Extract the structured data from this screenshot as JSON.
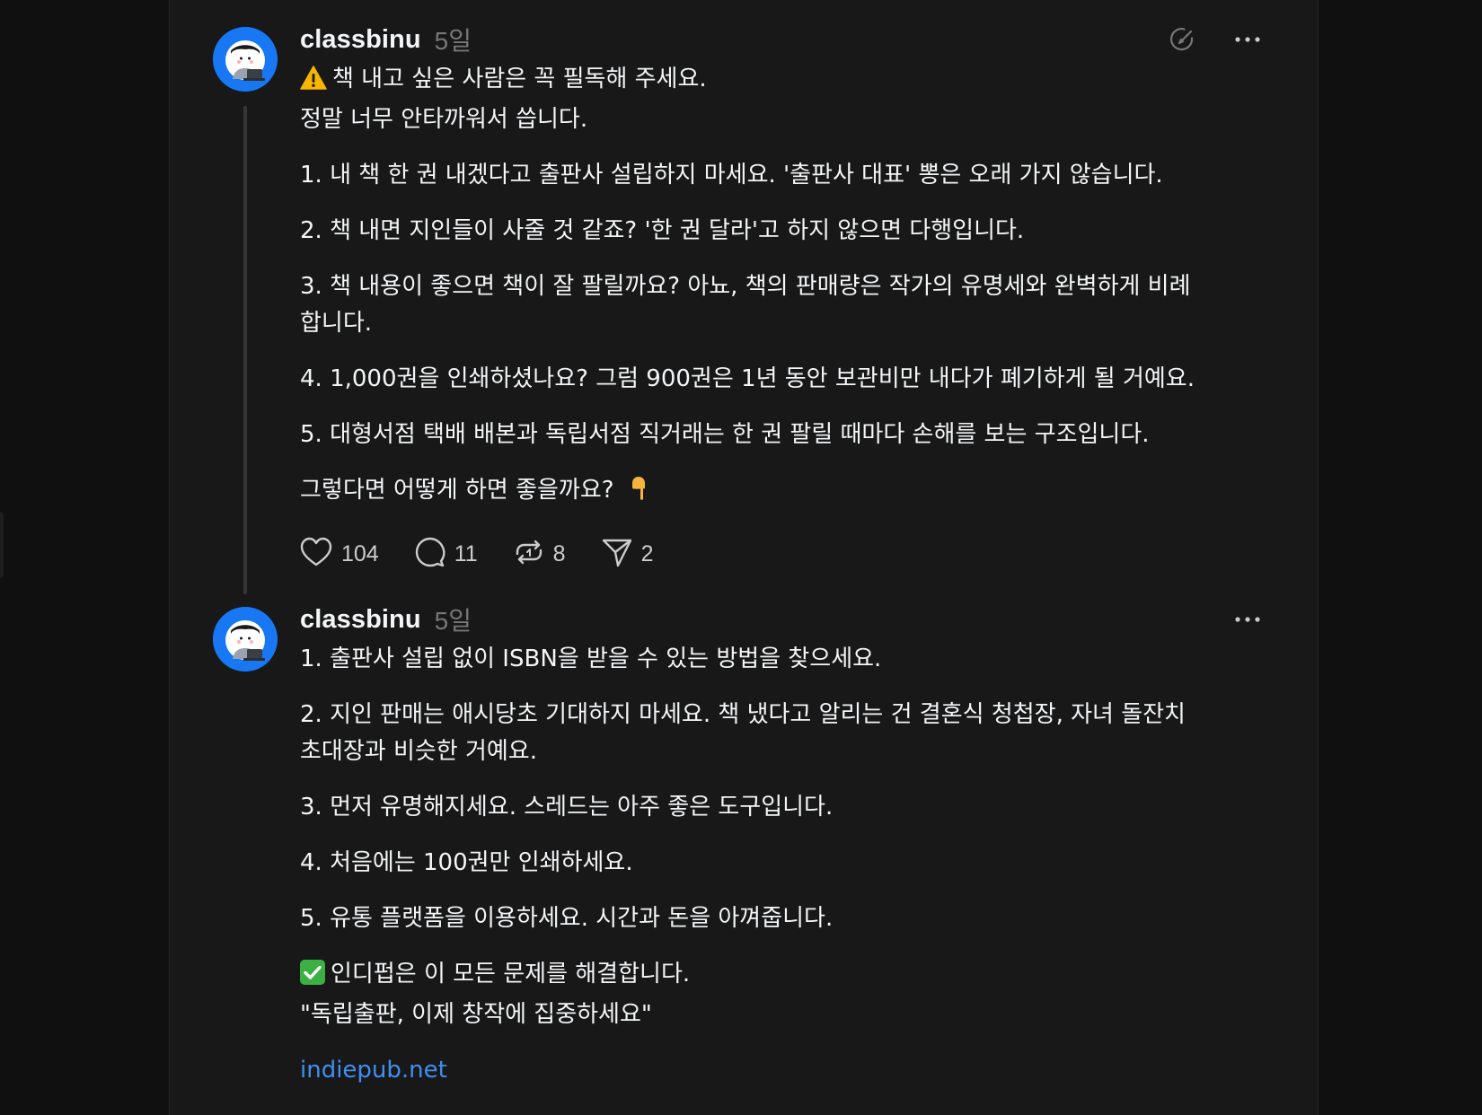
{
  "post1": {
    "username": "classbinu",
    "timestamp": "5일",
    "intro_line1": "책 내고 싶은 사람은 꼭 필독해 주세요.",
    "intro_line2": "정말 너무 안타까워서 씁니다.",
    "items": [
      {
        "lines": [
          "1. 내 책 한 권 내겠다고 출판사 설립하지 마세요. '출판사 대표' 뽕은 오래 가지 않습니다."
        ]
      },
      {
        "lines": [
          "2. 책 내면 지인들이 사줄 것 같죠? '한 권 달라'고 하지 않으면 다행입니다."
        ]
      },
      {
        "lines": [
          "3. 책 내용이 좋으면 책이 잘 팔릴까요? 아뇨, 책의 판매량은 작가의 유명세와 완벽하게 비례",
          "합니다."
        ]
      },
      {
        "lines": [
          "4. 1,000권을 인쇄하셨나요? 그럼 900권은 1년 동안 보관비만 내다가 폐기하게 될 거예요."
        ]
      },
      {
        "lines": [
          "5. 대형서점 택배 배본과 독립서점 직거래는 한 권 팔릴 때마다 손해를 보는 구조입니다."
        ]
      }
    ],
    "closing": "그렇다면 어떻게 하면 좋을까요?",
    "counts": {
      "likes": "104",
      "replies": "11",
      "reposts": "8",
      "shares": "2"
    }
  },
  "post2": {
    "username": "classbinu",
    "timestamp": "5일",
    "items": [
      {
        "lines": [
          "1. 출판사 설립 없이 ISBN을 받을 수 있는 방법을 찾으세요."
        ]
      },
      {
        "lines": [
          "2. 지인 판매는 애시당초 기대하지 마세요. 책 냈다고 알리는 건 결혼식 청첩장, 자녀 돌잔치",
          "초대장과 비슷한 거예요."
        ]
      },
      {
        "lines": [
          "3. 먼저 유명해지세요. 스레드는 아주 좋은 도구입니다."
        ]
      },
      {
        "lines": [
          "4. 처음에는 100권만 인쇄하세요."
        ]
      },
      {
        "lines": [
          "5. 유통 플랫폼을 이용하세요. 시간과 돈을 아껴줍니다."
        ]
      }
    ],
    "solution_line1": "인디펍은 이 모든 문제를 해결합니다.",
    "solution_line2": "\"독립출판, 이제 창작에 집중하세요\"",
    "link": "indiepub.net"
  },
  "colors": {
    "background": "#101010",
    "card": "#181818",
    "text": "#f3f5f7",
    "muted": "#777777",
    "link": "#3f8ff0",
    "avatar": "#1877f2"
  },
  "icons": [
    "warning-icon",
    "pointing-down-icon",
    "check-mark-icon",
    "heart-icon",
    "reply-icon",
    "repost-icon",
    "share-icon",
    "more-icon",
    "edit-icon"
  ]
}
